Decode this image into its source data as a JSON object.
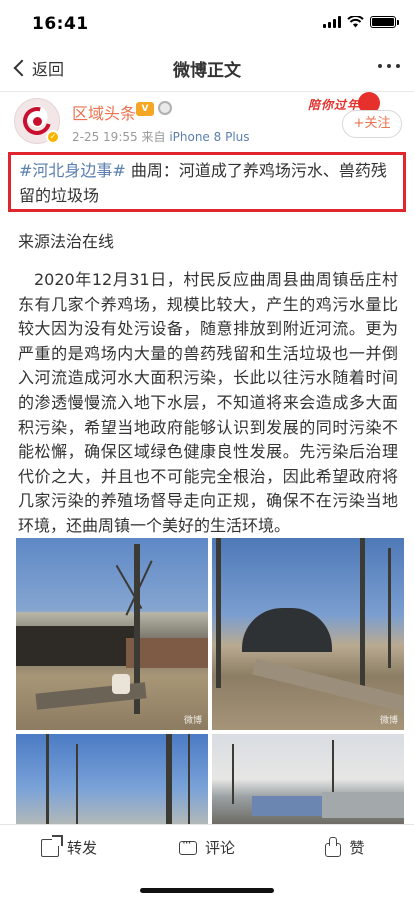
{
  "status_bar": {
    "time": "16:41"
  },
  "nav": {
    "back_label": "返回",
    "title": "微博正文"
  },
  "post": {
    "author": "区域头条",
    "vip_badge": "V",
    "date": "2-25 19:55",
    "source_prefix": "来自",
    "device": "iPhone 8 Plus",
    "promo_text": "陪你过年",
    "follow_label": "+关注",
    "topic": "#河北身边事#",
    "headline": "曲周：河道成了养鸡场污水、兽药残留的垃圾场",
    "source_line": "来源法治在线",
    "body": "2020年12月31日，村民反应曲周县曲周镇岳庄村东有几家个养鸡场，规模比较大，产生的鸡污水量比较大因为没有处污设备，随意排放到附近河流。更为严重的是鸡场内大量的兽药残留和生活垃圾也一并倒入河流造成河水大面积污染，长此以往污水随着时间的渗透慢慢流入地下水层，不知道将来会造成多大面积污染，希望当地政府能够认识到发展的同时污染不能松懈，确保区域绿色健康良性发展。先污染后治理代价之大，并且也不可能完全根治，因此希望政府将几家污染的养殖场督导走向正规，确保不在污染当地环境，还曲周镇一个美好的生活环境。",
    "photos": [
      {
        "icon": "photo-farm-shed",
        "watermark": "微博"
      },
      {
        "icon": "photo-greenhouse-trough",
        "watermark": "微博"
      },
      {
        "icon": "photo-trees-sky",
        "watermark": ""
      },
      {
        "icon": "photo-village-buildings",
        "watermark": ""
      }
    ]
  },
  "actions": {
    "forward_label": "转发",
    "comment_label": "评论",
    "like_label": "赞"
  },
  "colors": {
    "accent_orange": "#eb7350",
    "link_blue": "#5b7fb0",
    "highlight_red": "#e0262c"
  }
}
